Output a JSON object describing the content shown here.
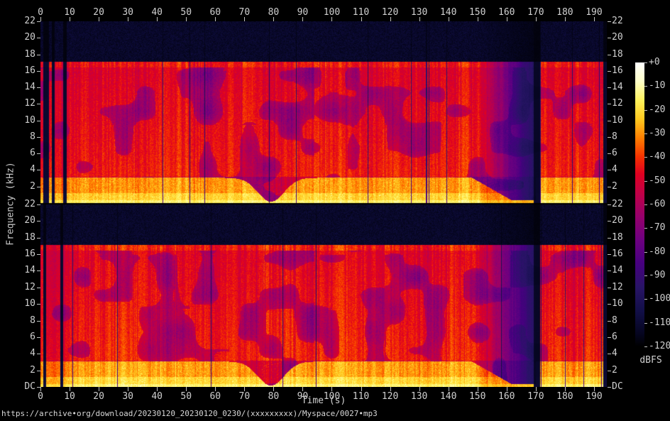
{
  "chart_data": {
    "type": "heatmap",
    "subtype": "audio-spectrogram-stereo",
    "title": "",
    "xlabel": "Time (s)",
    "ylabel": "Frequency (kHz)",
    "x_ticks": [
      0,
      10,
      20,
      30,
      40,
      50,
      60,
      70,
      80,
      90,
      100,
      110,
      120,
      130,
      140,
      150,
      160,
      170,
      180,
      190
    ],
    "x_range_s": [
      0,
      194.4
    ],
    "grid": false,
    "panels": [
      {
        "name": "channel-1",
        "freq_range_khz": [
          0,
          22
        ],
        "freq_ticks": [
          {
            "v": 22,
            "label": "22"
          },
          {
            "v": 20,
            "label": "20"
          },
          {
            "v": 18,
            "label": "18"
          },
          {
            "v": 16,
            "label": "16"
          },
          {
            "v": 14,
            "label": "14"
          },
          {
            "v": 12,
            "label": "12"
          },
          {
            "v": 10,
            "label": "10"
          },
          {
            "v": 8,
            "label": "8"
          },
          {
            "v": 6,
            "label": "6"
          },
          {
            "v": 4,
            "label": "4"
          },
          {
            "v": 2,
            "label": "2"
          }
        ]
      },
      {
        "name": "channel-2",
        "freq_range_khz": [
          0,
          22
        ],
        "freq_ticks": [
          {
            "v": 22,
            "label": "22"
          },
          {
            "v": 20,
            "label": "20"
          },
          {
            "v": 18,
            "label": "18"
          },
          {
            "v": 16,
            "label": "16"
          },
          {
            "v": 14,
            "label": "14"
          },
          {
            "v": 12,
            "label": "12"
          },
          {
            "v": 10,
            "label": "10"
          },
          {
            "v": 8,
            "label": "8"
          },
          {
            "v": 6,
            "label": "6"
          },
          {
            "v": 4,
            "label": "4"
          },
          {
            "v": 2,
            "label": "2"
          },
          {
            "v": 0,
            "label": "DC"
          }
        ]
      }
    ],
    "colorbar": {
      "label": "dBFS",
      "range_db": [
        0,
        -120
      ],
      "ticks": [
        {
          "db": 0,
          "label": "+0"
        },
        {
          "db": -10,
          "label": "-10"
        },
        {
          "db": -20,
          "label": "-20"
        },
        {
          "db": -30,
          "label": "-30"
        },
        {
          "db": -40,
          "label": "-40"
        },
        {
          "db": -50,
          "label": "-50"
        },
        {
          "db": -60,
          "label": "-60"
        },
        {
          "db": -70,
          "label": "-70"
        },
        {
          "db": -80,
          "label": "-80"
        },
        {
          "db": -90,
          "label": "-90"
        },
        {
          "db": -100,
          "label": "-100"
        },
        {
          "db": -110,
          "label": "-110"
        },
        {
          "db": -120,
          "label": "-120"
        }
      ],
      "stops": [
        {
          "db": 0,
          "color": "#ffffff"
        },
        {
          "db": -8,
          "color": "#ffffc8"
        },
        {
          "db": -16,
          "color": "#fff25c"
        },
        {
          "db": -24,
          "color": "#ffc81e"
        },
        {
          "db": -32,
          "color": "#ff7d00"
        },
        {
          "db": -40,
          "color": "#f53000"
        },
        {
          "db": -47,
          "color": "#e00020"
        },
        {
          "db": -55,
          "color": "#c20045"
        },
        {
          "db": -65,
          "color": "#97006b"
        },
        {
          "db": -75,
          "color": "#6d0080"
        },
        {
          "db": -85,
          "color": "#470080"
        },
        {
          "db": -95,
          "color": "#281466"
        },
        {
          "db": -105,
          "color": "#120f48"
        },
        {
          "db": -115,
          "color": "#05051e"
        },
        {
          "db": -120,
          "color": "#000000"
        }
      ]
    },
    "render_params": {
      "t_max_s": 194.4,
      "cutoff_khz": 16.9,
      "low_band_top_khz": 3.1,
      "intro_end_s": 9,
      "dip_center_s": 79,
      "dip_width_s": 4.5,
      "fade_start_s": 150,
      "fade_end_s": 169.3,
      "silence_gap_s": [
        169.3,
        171.4
      ],
      "outro_end_s": 193,
      "seeds": [
        101,
        202
      ]
    },
    "footer_text": "https://archive•org/download/20230120_20230120_0230/(xxxxxxxxx)/Myspace/0027•mp3"
  }
}
